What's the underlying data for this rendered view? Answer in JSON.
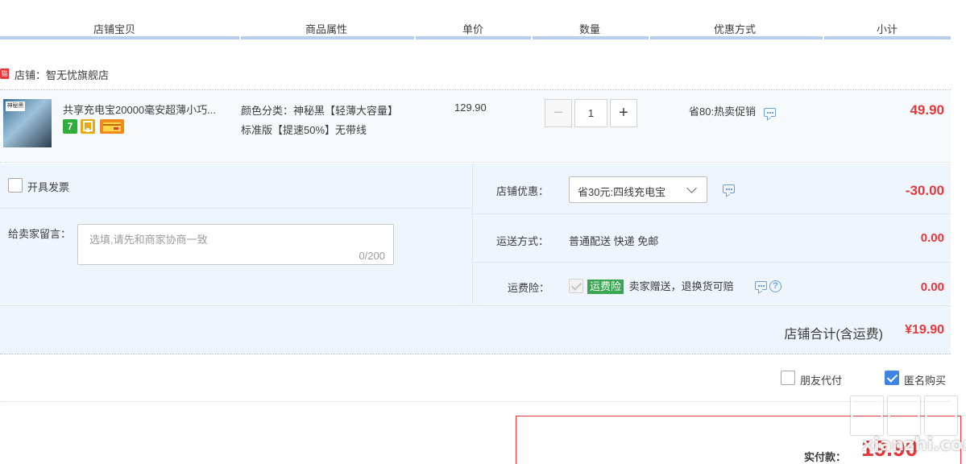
{
  "header": {
    "columns": [
      "店铺宝贝",
      "商品属性",
      "单价",
      "数量",
      "优惠方式",
      "小计"
    ]
  },
  "shop": {
    "tmall_badge": "猫",
    "label": "店铺：智无忧旗舰店"
  },
  "item": {
    "thumb_label": "神秘黑",
    "title": "共享充电宝20000毫安超薄小巧...",
    "badge_7": "7",
    "props_line1": "颜色分类：神秘黑【轻薄大容量】",
    "props_line2": "标准版【提速50%】无带线",
    "unit_price": "129.90",
    "quantity": "1",
    "minus": "−",
    "plus": "+",
    "promo": "省80:热卖促销",
    "subtotal": "49.90"
  },
  "extra": {
    "invoice_label": "开具发票",
    "message_label": "给卖家留言：",
    "message_placeholder": "选填,请先和商家协商一致",
    "message_counter": "0/200",
    "shop_discount_label": "店铺优惠：",
    "shop_discount_value": "省30元:四线充电宝",
    "shop_discount_amount": "-30.00",
    "shipping_label": "运送方式：",
    "shipping_value": "普通配送 快递 免邮",
    "shipping_amount": "0.00",
    "insurance_label": "运费险：",
    "insurance_tag": "运费险",
    "insurance_desc": "卖家赠送，退换货可赔",
    "insurance_help": "?",
    "insurance_amount": "0.00"
  },
  "total": {
    "label": "店铺合计(含运费)",
    "amount": "¥19.90"
  },
  "options": {
    "friend_pay": "朋友代付",
    "friend_pay_checked": false,
    "anonymous": "匿名购买",
    "anonymous_checked": true
  },
  "payment": {
    "label": "实付款：",
    "amount": "19.90"
  },
  "watermark": {
    "text": "值值值",
    "sub": "xianzhi.com"
  },
  "colors": {
    "accent_red": "#e4393c",
    "header_bar": "#b7cfef",
    "panel_bg": "#eff5fd",
    "green_tag": "#3aa552",
    "link_blue": "#6aa0d8",
    "checkbox_blue": "#3e84e3"
  },
  "icons": [
    "tmall-icon",
    "chat-icon",
    "help-icon",
    "chevron-down-icon",
    "checkbox-icon"
  ]
}
